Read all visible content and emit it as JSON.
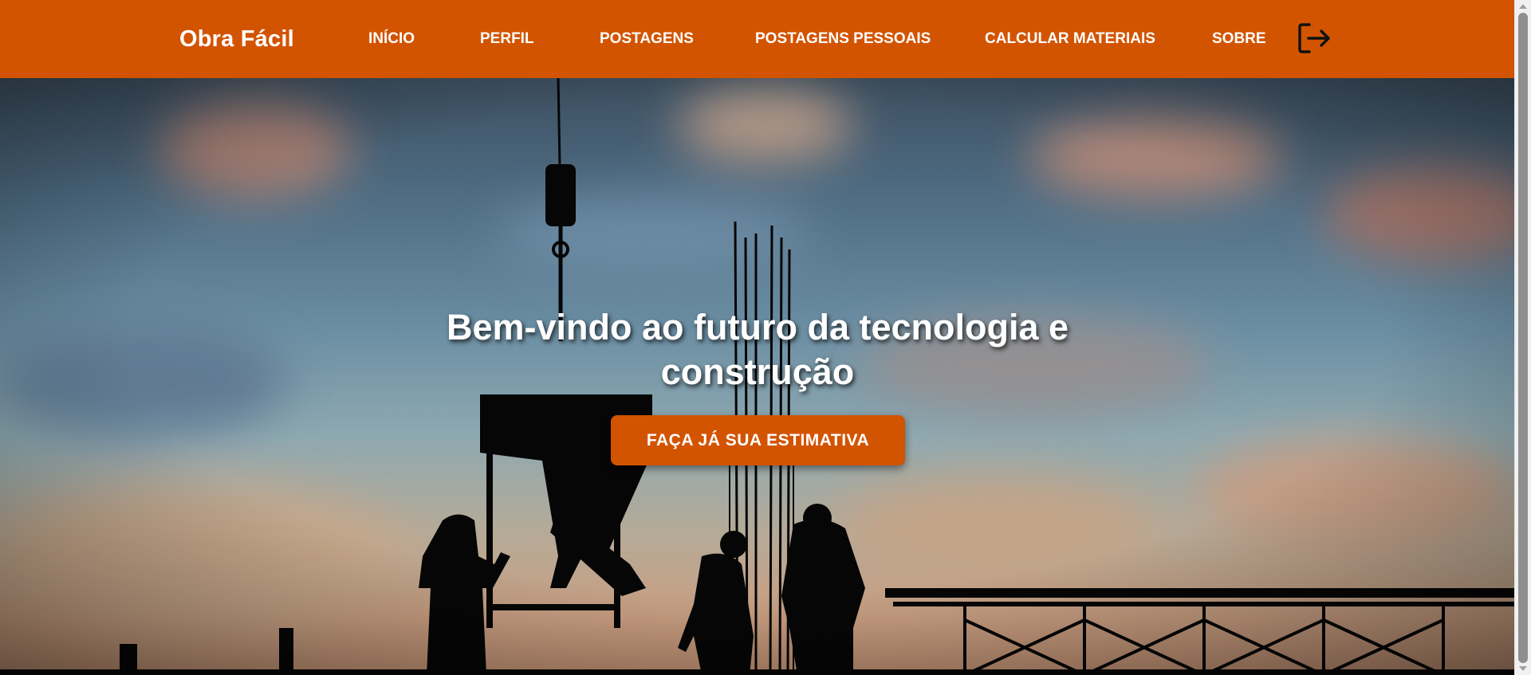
{
  "brand": {
    "name": "Obra Fácil"
  },
  "nav": {
    "links": [
      {
        "label": "INÍCIO"
      },
      {
        "label": "PERFIL"
      },
      {
        "label": "POSTAGENS"
      },
      {
        "label": "POSTAGENS PESSOAIS"
      },
      {
        "label": "CALCULAR MATERIAIS"
      },
      {
        "label": "SOBRE"
      }
    ],
    "logout_icon": "logout-icon"
  },
  "hero": {
    "title": "Bem-vindo ao futuro da tecnologia e construção",
    "cta_label": "FAÇA JÁ SUA ESTIMATIVA"
  },
  "colors": {
    "primary": "#d35400",
    "text_light": "#ffffff"
  }
}
